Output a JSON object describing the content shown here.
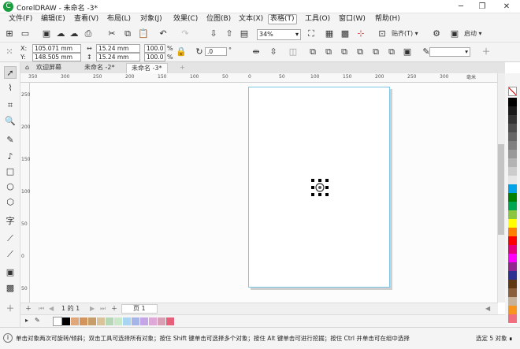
{
  "window": {
    "title": "CorelDRAW - 未命名 -3*",
    "logo_glyph": "C"
  },
  "menu": {
    "items": [
      "文件(F)",
      "编辑(E)",
      "查看(V)",
      "布局(L)",
      "对象(J)",
      "效果(C)",
      "位图(B)",
      "文本(X)",
      "表格(T)",
      "工具(O)",
      "窗口(W)",
      "帮助(H)"
    ],
    "active": "表格(T)"
  },
  "toolbar1": {
    "zoom": "34%",
    "snap_label": "贴齐(T)",
    "launch_label": "启动"
  },
  "toolbar2": {
    "x_label": "X:",
    "y_label": "Y:",
    "x_value": "105.071 mm",
    "y_value": "148.505 mm",
    "w_value": "15.24 mm",
    "h_value": "15.24 mm",
    "scale_w": "100.0",
    "scale_h": "100.0",
    "percent": "%",
    "rotation": ".0",
    "degree": "°"
  },
  "tabs": {
    "welcome": "欢迎屏幕",
    "doc1": "未命名 -2*",
    "doc2": "未命名 -3*",
    "add": "+"
  },
  "ruler": {
    "h_labels": [
      "350",
      "300",
      "250",
      "200",
      "150",
      "100",
      "50",
      "0",
      "50",
      "100",
      "150",
      "200",
      "250",
      "300"
    ],
    "v_labels": [
      "250",
      "200",
      "150",
      "100",
      "50",
      "0",
      "50"
    ],
    "unit": "毫米"
  },
  "pagebar": {
    "counter": "1 的 1",
    "page_tab": "页 1"
  },
  "colors": {
    "palette": [
      "#ffffff",
      "#000000",
      "#1a1a1a",
      "#333333",
      "#4d4d4d",
      "#666666",
      "#808080",
      "#999999",
      "#b3b3b3",
      "#cccccc",
      "#e6e6e6",
      "#00a2e8",
      "#008000",
      "#00a651",
      "#8cc63f",
      "#ffff00",
      "#ff7f00",
      "#ff0000",
      "#e6007e",
      "#ff00ff",
      "#92278f",
      "#2e3192",
      "#603913",
      "#8b5e3c",
      "#c7b299",
      "#f7941d",
      "#f26d7d"
    ],
    "doc_palette": [
      "#ffffff",
      "#000000",
      "#e0a878",
      "#d3955d",
      "#c79e6a",
      "#d9c39b",
      "#b5d7b5",
      "#c8e8c8",
      "#a9d5f5",
      "#a5b5e8",
      "#c6a5e6",
      "#e0a8d8",
      "#d9a0b5",
      "#e6607a"
    ]
  },
  "status": {
    "text": "单击对象两次可旋转/倾斜；双击工具可选择所有对象；按住 Shift 键单击可选择多个对象；按住 Alt 键单击可进行挖掘；按住 Ctrl 并单击可在组中选择",
    "selection": "选定 5 对象 ∎"
  }
}
